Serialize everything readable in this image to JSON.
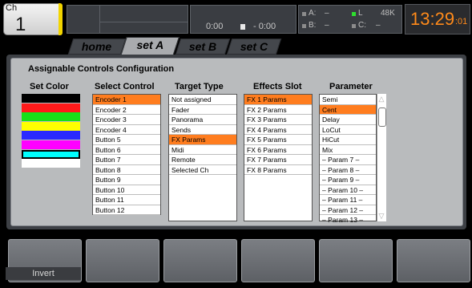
{
  "header": {
    "channel_label": "Ch",
    "channel_number": "1",
    "time_elapsed": "0:00",
    "time_remaining": "- 0:00",
    "slot_a": "A:",
    "slot_a_value": "–",
    "slot_b": "B:",
    "slot_b_value": "–",
    "slot_l": "L",
    "sample_rate": "48K",
    "slot_c": "C:",
    "slot_c_value": "–",
    "clock_time": "13:29",
    "clock_seconds": ":01",
    "channel_color": "#f2d500",
    "clock_color": "#ff8a1a"
  },
  "tabs": [
    {
      "label": "home"
    },
    {
      "label": "set A"
    },
    {
      "label": "set B"
    },
    {
      "label": "set C"
    }
  ],
  "panel": {
    "title": "Assignable Controls Configuration",
    "headers": {
      "set_color": "Set Color",
      "select_control": "Select Control",
      "target_type": "Target Type",
      "effects_slot": "Effects Slot",
      "parameter": "Parameter"
    },
    "colors": [
      "#000000",
      "#ff1a1a",
      "#18e018",
      "#ffff00",
      "#2a2aff",
      "#ff00ff",
      "#00ffff",
      "#ffffff"
    ],
    "selected_color": "#00ffff",
    "select_control": [
      "Encoder 1",
      "Encoder 2",
      "Encoder 3",
      "Encoder 4",
      "Button 5",
      "Button 6",
      "Button 7",
      "Button 8",
      "Button 9",
      "Button  10",
      "Button  11",
      "Button  12"
    ],
    "select_control_selected": "Encoder 1",
    "target_type": [
      "Not assigned",
      "Fader",
      "Panorama",
      "Sends",
      "FX Params",
      "Midi",
      "Remote",
      "Selected Ch"
    ],
    "target_type_selected": "FX Params",
    "effects_slot": [
      "FX 1 Params",
      "FX 2 Params",
      "FX 3 Params",
      "FX 4 Params",
      "FX 5 Params",
      "FX 6 Params",
      "FX 7 Params",
      "FX 8 Params"
    ],
    "effects_slot_selected": "FX 1 Params",
    "parameter": [
      "Semi",
      "Cent",
      "Delay",
      "LoCut",
      "HiCut",
      "Mix",
      "– Param 7 –",
      "– Param 8 –",
      "– Param 9 –",
      "– Param 10 –",
      "– Param 11 –",
      "– Param 12 –",
      "– Param 13 –"
    ],
    "parameter_selected": "Cent",
    "selection_color": "#ff7d1f"
  },
  "bottom_buttons": [
    {
      "label": "Invert"
    },
    {
      "label": ""
    },
    {
      "label": ""
    },
    {
      "label": ""
    },
    {
      "label": ""
    },
    {
      "label": ""
    }
  ]
}
